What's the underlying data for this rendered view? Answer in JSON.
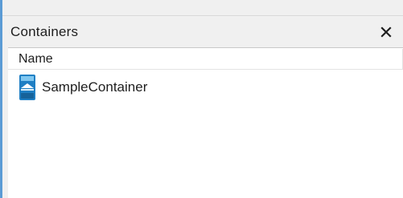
{
  "panel": {
    "title": "Containers",
    "close_glyph": "✕",
    "close_icon": "close-icon"
  },
  "list": {
    "columns": [
      {
        "label": "Name"
      }
    ],
    "rows": [
      {
        "label": "SampleContainer",
        "icon": "container-icon"
      }
    ]
  },
  "colors": {
    "accent_border": "#5b9bd5",
    "icon_blue": "#1f7fc4",
    "icon_light": "#7fc7f0"
  }
}
